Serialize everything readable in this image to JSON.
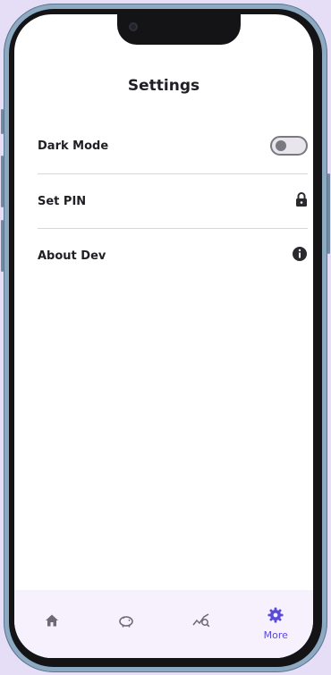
{
  "page": {
    "title": "Settings"
  },
  "settings": {
    "items": [
      {
        "label": "Dark Mode",
        "control": "toggle",
        "state": "off"
      },
      {
        "label": "Set PIN",
        "icon": "lock-icon"
      },
      {
        "label": "About Dev",
        "icon": "info-icon"
      }
    ]
  },
  "nav": {
    "items": [
      {
        "icon": "home-icon",
        "label": ""
      },
      {
        "icon": "piggy-bank-icon",
        "label": ""
      },
      {
        "icon": "chart-search-icon",
        "label": ""
      },
      {
        "icon": "gear-icon",
        "label": "More",
        "active": true
      }
    ]
  },
  "colors": {
    "accent": "#5a4ad8",
    "background": "#e6ddf7",
    "frame": "#8eaac3",
    "text": "#1f1f24"
  }
}
